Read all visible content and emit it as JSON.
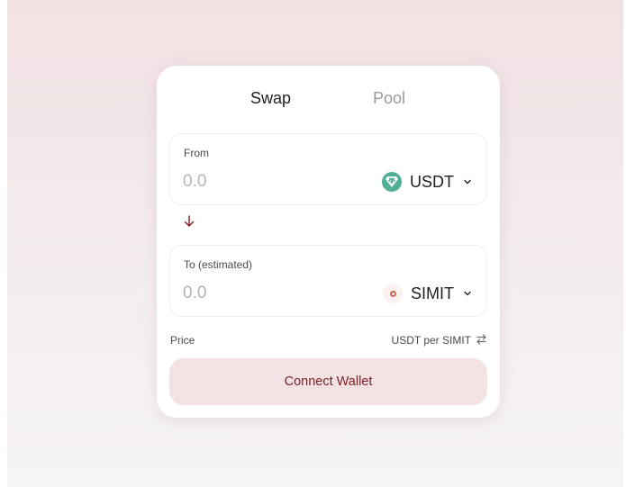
{
  "tabs": [
    {
      "label": "Swap"
    },
    {
      "label": "Pool"
    }
  ],
  "from": {
    "label": "From",
    "placeholder": "0.0",
    "token": {
      "symbol": "USDT",
      "icon": "usdt-token-icon"
    }
  },
  "to": {
    "label": "To (estimated)",
    "placeholder": "0.0",
    "token": {
      "symbol": "SIMIT",
      "icon": "simit-token-icon"
    }
  },
  "price": {
    "label": "Price",
    "unit": "USDT per SIMIT"
  },
  "connect_button": {
    "label": "Connect Wallet"
  },
  "colors": {
    "accent": "#7a1f26",
    "button_bg": "#f2e2e3",
    "usdt": "#50af95",
    "simit": "#c7664f"
  }
}
